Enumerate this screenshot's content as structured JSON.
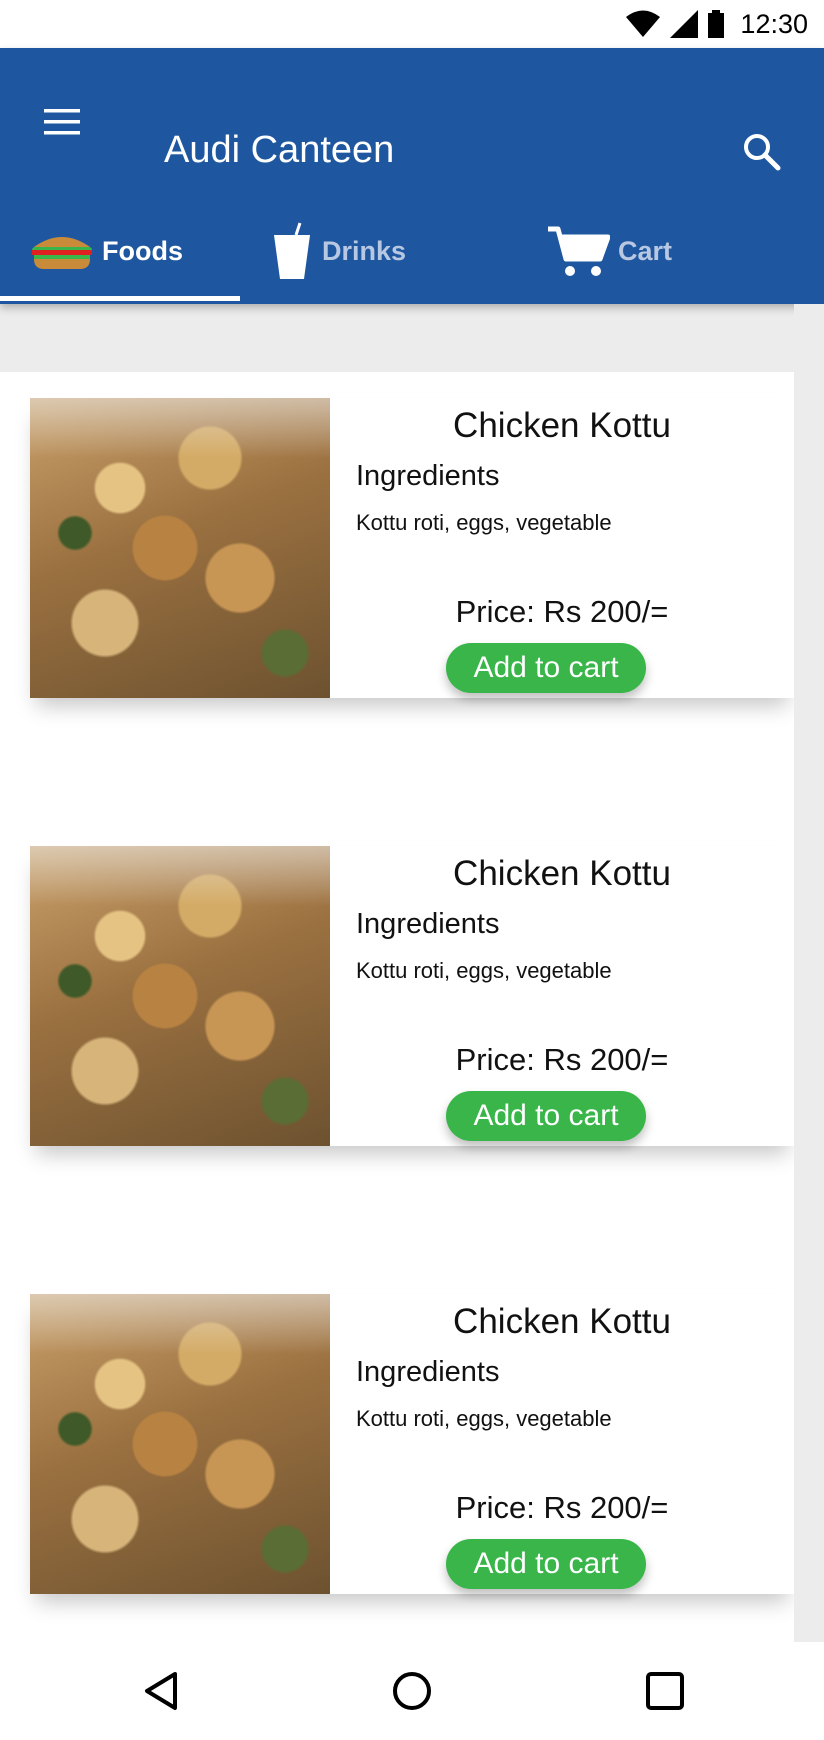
{
  "status_bar": {
    "time": "12:30"
  },
  "app_bar": {
    "title": "Audi Canteen"
  },
  "tabs": [
    {
      "label": "Foods",
      "icon": "burger-icon",
      "active": true
    },
    {
      "label": "Drinks",
      "icon": "drink-cup-icon",
      "active": false
    },
    {
      "label": "Cart",
      "icon": "cart-icon",
      "active": false
    }
  ],
  "items": [
    {
      "name": "Chicken Kottu",
      "ingredients_title": "Ingredients",
      "ingredients": "Kottu roti, eggs, vegetable",
      "price": "Price: Rs 200/=",
      "button": "Add to cart"
    },
    {
      "name": "Chicken Kottu",
      "ingredients_title": "Ingredients",
      "ingredients": "Kottu roti, eggs, vegetable",
      "price": "Price: Rs 200/=",
      "button": "Add to cart"
    },
    {
      "name": "Chicken Kottu",
      "ingredients_title": "Ingredients",
      "ingredients": "Kottu roti, eggs, vegetable",
      "price": "Price: Rs 200/=",
      "button": "Add to cart"
    }
  ],
  "colors": {
    "primary": "#1e57a0",
    "accent_button": "#39b54a",
    "tab_inactive": "#b9c8e2"
  }
}
